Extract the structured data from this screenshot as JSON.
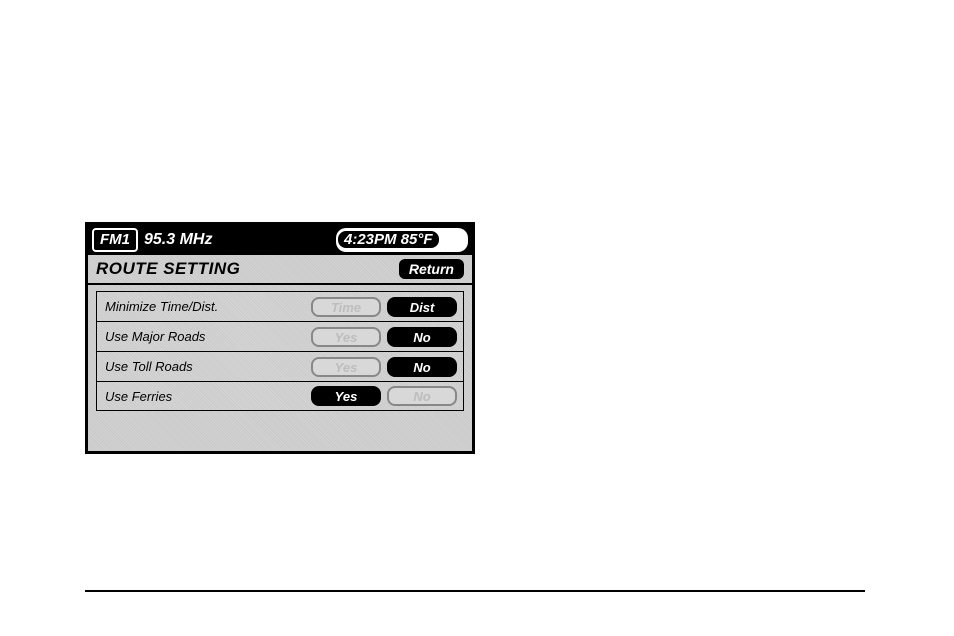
{
  "topbar": {
    "band": "FM1",
    "frequency": "95.3 MHz",
    "clock": "4:23PM 85°F"
  },
  "header": {
    "title": "ROUTE SETTING",
    "return_label": "Return"
  },
  "rows": [
    {
      "label": "Minimize Time/Dist.",
      "opt_a": "Time",
      "opt_b": "Dist",
      "selected": "b"
    },
    {
      "label": "Use Major Roads",
      "opt_a": "Yes",
      "opt_b": "No",
      "selected": "b"
    },
    {
      "label": "Use Toll Roads",
      "opt_a": "Yes",
      "opt_b": "No",
      "selected": "b"
    },
    {
      "label": "Use Ferries",
      "opt_a": "Yes",
      "opt_b": "No",
      "selected": "a"
    }
  ]
}
